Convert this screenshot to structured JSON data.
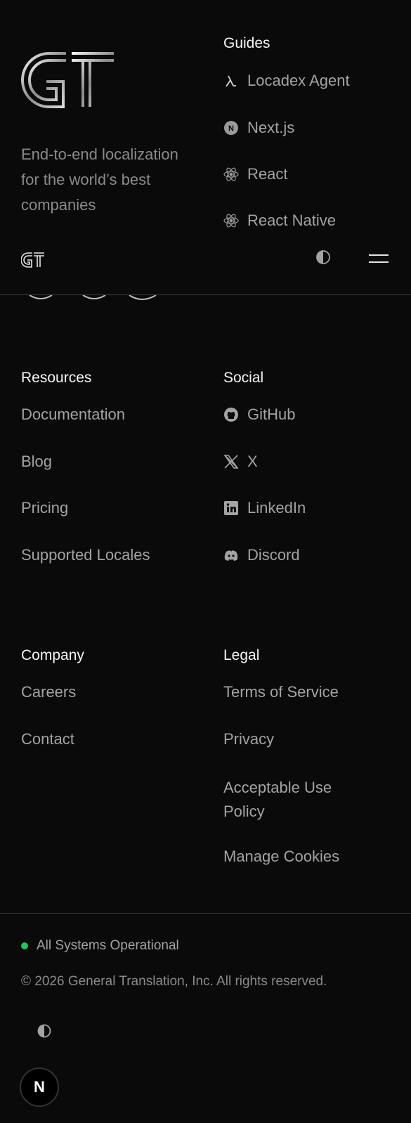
{
  "brand": {
    "tagline": "End-to-end localization for the world’s best companies"
  },
  "guides": {
    "heading": "Guides",
    "items": [
      {
        "label": "Locadex Agent",
        "icon": "lambda-icon"
      },
      {
        "label": "Next.js",
        "icon": "nextjs-icon"
      },
      {
        "label": "React",
        "icon": "react-icon"
      },
      {
        "label": "React Native",
        "icon": "react-icon"
      }
    ]
  },
  "resources": {
    "heading": "Resources",
    "items": [
      "Documentation",
      "Blog",
      "Pricing",
      "Supported Locales"
    ]
  },
  "social": {
    "heading": "Social",
    "items": [
      {
        "label": "GitHub",
        "icon": "github-icon"
      },
      {
        "label": "X",
        "icon": "x-icon"
      },
      {
        "label": "LinkedIn",
        "icon": "linkedin-icon"
      },
      {
        "label": "Discord",
        "icon": "discord-icon"
      }
    ]
  },
  "company": {
    "heading": "Company",
    "items": [
      "Careers",
      "Contact"
    ]
  },
  "legal": {
    "heading": "Legal",
    "items": [
      "Terms of Service",
      "Privacy",
      "Acceptable Use Policy",
      "Manage Cookies"
    ]
  },
  "footer": {
    "status": "All Systems Operational",
    "status_color": "#22c55e",
    "copyright": "© 2026 General Translation, Inc. All rights reserved."
  },
  "next_badge": {
    "label": "N"
  }
}
